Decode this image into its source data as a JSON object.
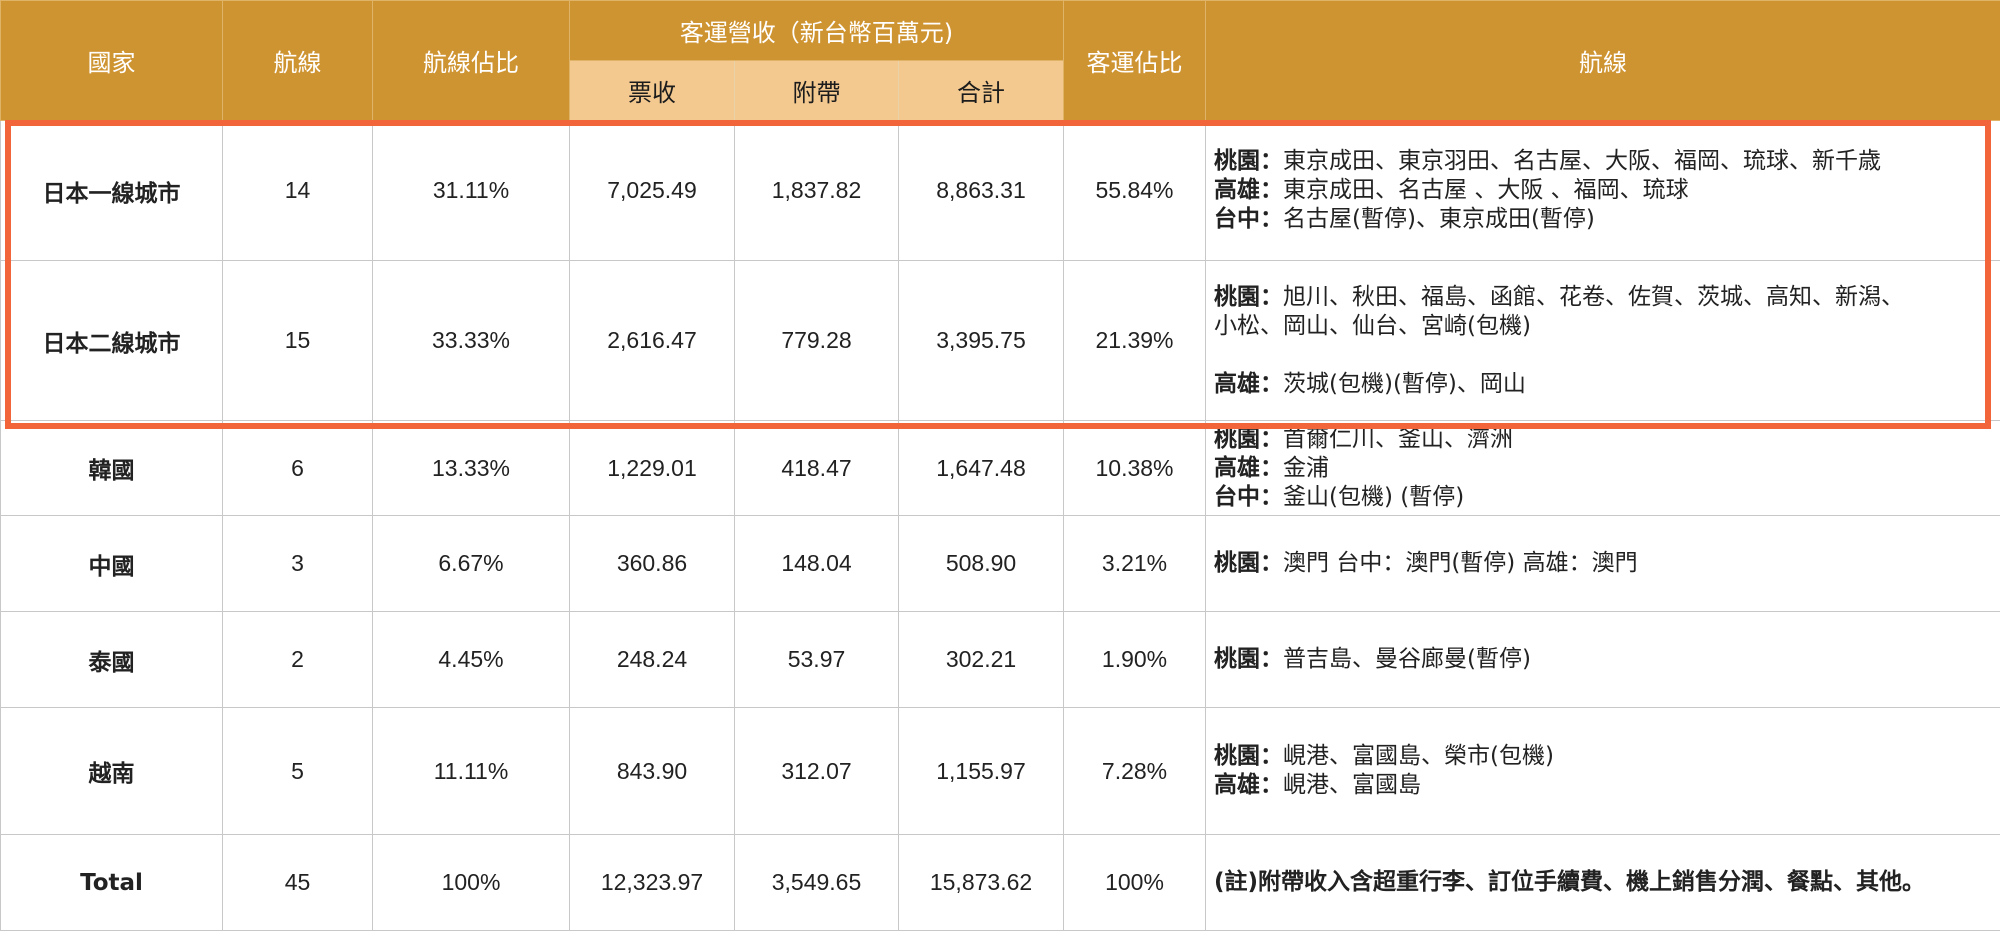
{
  "colors": {
    "header_bg": "#cf9432",
    "subheader_bg": "#f3c990",
    "highlight_border": "#f2643a"
  },
  "header": {
    "country": "國家",
    "routes_count": "航線",
    "route_share": "航線佔比",
    "revenue_group": "客運營收（新台幣百萬元)",
    "ticket": "票收",
    "ancillary": "附帶",
    "total": "合計",
    "revenue_share": "客運佔比",
    "routes": "航線"
  },
  "rows": [
    {
      "country": "日本一線城市",
      "routes_count": "14",
      "route_share": "31.11%",
      "ticket": "7,025.49",
      "ancillary": "1,837.82",
      "total": "8,863.31",
      "revenue_share": "55.84%",
      "routes": [
        {
          "base": "桃園：",
          "text": "東京成田、東京羽田、名古屋、大阪、福岡、琉球、新千歳"
        },
        {
          "base": "高雄：",
          "text": "東京成田、名古屋 、大阪 、福岡、琉球"
        },
        {
          "base": "台中：",
          "text": "名古屋(暫停)、東京成田(暫停)"
        }
      ]
    },
    {
      "country": "日本二線城市",
      "routes_count": "15",
      "route_share": "33.33%",
      "ticket": "2,616.47",
      "ancillary": "779.28",
      "total": "3,395.75",
      "revenue_share": "21.39%",
      "routes": [
        {
          "base": "桃園：",
          "text": "旭川、秋田、福島、函館、花卷、佐賀、茨城、高知、新潟、"
        },
        {
          "base": "",
          "text": "小松、岡山、仙台、宮崎(包機)"
        },
        {
          "base": "高雄：",
          "text": "茨城(包機)(暫停)、岡山"
        }
      ]
    },
    {
      "country": "韓國",
      "routes_count": "6",
      "route_share": "13.33%",
      "ticket": "1,229.01",
      "ancillary": "418.47",
      "total": "1,647.48",
      "revenue_share": "10.38%",
      "routes": [
        {
          "base": "桃園：",
          "text": "首爾仁川、釜山、濟洲"
        },
        {
          "base": "高雄：",
          "text": "金浦"
        },
        {
          "base": "台中：",
          "text": "釜山(包機) (暫停)"
        }
      ]
    },
    {
      "country": "中國",
      "routes_count": "3",
      "route_share": "6.67%",
      "ticket": "360.86",
      "ancillary": "148.04",
      "total": "508.90",
      "revenue_share": "3.21%",
      "routes": [
        {
          "base": "桃園：",
          "text": "澳門 台中：澳門(暫停) 高雄：澳門"
        }
      ]
    },
    {
      "country": "泰國",
      "routes_count": "2",
      "route_share": "4.45%",
      "ticket": "248.24",
      "ancillary": "53.97",
      "total": "302.21",
      "revenue_share": "1.90%",
      "routes": [
        {
          "base": "桃園：",
          "text": "普吉島、曼谷廊曼(暫停)"
        }
      ]
    },
    {
      "country": "越南",
      "routes_count": "5",
      "route_share": "11.11%",
      "ticket": "843.90",
      "ancillary": "312.07",
      "total": "1,155.97",
      "revenue_share": "7.28%",
      "routes": [
        {
          "base": "桃園：",
          "text": "峴港、富國島、榮市(包機)"
        },
        {
          "base": "高雄：",
          "text": "峴港、富國島"
        }
      ]
    },
    {
      "country": "Total",
      "routes_count": "45",
      "route_share": "100%",
      "ticket": "12,323.97",
      "ancillary": "3,549.65",
      "total": "15,873.62",
      "revenue_share": "100%",
      "note": "(註)附帶收入含超重行李、訂位手續費、機上銷售分潤、餐點、其他。"
    }
  ]
}
